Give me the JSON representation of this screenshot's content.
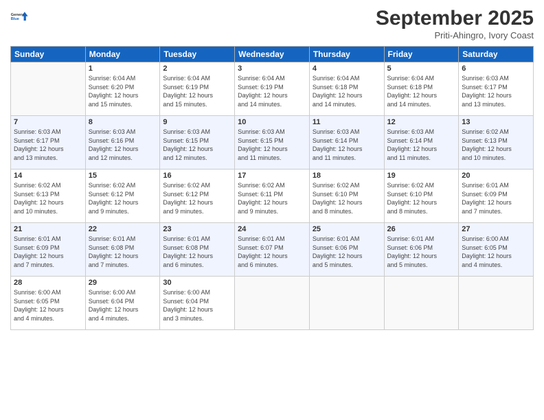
{
  "logo": {
    "line1": "General",
    "line2": "Blue"
  },
  "title": "September 2025",
  "location": "Priti-Ahingro, Ivory Coast",
  "days_of_week": [
    "Sunday",
    "Monday",
    "Tuesday",
    "Wednesday",
    "Thursday",
    "Friday",
    "Saturday"
  ],
  "weeks": [
    [
      {
        "num": "",
        "info": ""
      },
      {
        "num": "1",
        "info": "Sunrise: 6:04 AM\nSunset: 6:20 PM\nDaylight: 12 hours\nand 15 minutes."
      },
      {
        "num": "2",
        "info": "Sunrise: 6:04 AM\nSunset: 6:19 PM\nDaylight: 12 hours\nand 15 minutes."
      },
      {
        "num": "3",
        "info": "Sunrise: 6:04 AM\nSunset: 6:19 PM\nDaylight: 12 hours\nand 14 minutes."
      },
      {
        "num": "4",
        "info": "Sunrise: 6:04 AM\nSunset: 6:18 PM\nDaylight: 12 hours\nand 14 minutes."
      },
      {
        "num": "5",
        "info": "Sunrise: 6:04 AM\nSunset: 6:18 PM\nDaylight: 12 hours\nand 14 minutes."
      },
      {
        "num": "6",
        "info": "Sunrise: 6:03 AM\nSunset: 6:17 PM\nDaylight: 12 hours\nand 13 minutes."
      }
    ],
    [
      {
        "num": "7",
        "info": "Sunrise: 6:03 AM\nSunset: 6:17 PM\nDaylight: 12 hours\nand 13 minutes."
      },
      {
        "num": "8",
        "info": "Sunrise: 6:03 AM\nSunset: 6:16 PM\nDaylight: 12 hours\nand 12 minutes."
      },
      {
        "num": "9",
        "info": "Sunrise: 6:03 AM\nSunset: 6:15 PM\nDaylight: 12 hours\nand 12 minutes."
      },
      {
        "num": "10",
        "info": "Sunrise: 6:03 AM\nSunset: 6:15 PM\nDaylight: 12 hours\nand 11 minutes."
      },
      {
        "num": "11",
        "info": "Sunrise: 6:03 AM\nSunset: 6:14 PM\nDaylight: 12 hours\nand 11 minutes."
      },
      {
        "num": "12",
        "info": "Sunrise: 6:03 AM\nSunset: 6:14 PM\nDaylight: 12 hours\nand 11 minutes."
      },
      {
        "num": "13",
        "info": "Sunrise: 6:02 AM\nSunset: 6:13 PM\nDaylight: 12 hours\nand 10 minutes."
      }
    ],
    [
      {
        "num": "14",
        "info": "Sunrise: 6:02 AM\nSunset: 6:13 PM\nDaylight: 12 hours\nand 10 minutes."
      },
      {
        "num": "15",
        "info": "Sunrise: 6:02 AM\nSunset: 6:12 PM\nDaylight: 12 hours\nand 9 minutes."
      },
      {
        "num": "16",
        "info": "Sunrise: 6:02 AM\nSunset: 6:12 PM\nDaylight: 12 hours\nand 9 minutes."
      },
      {
        "num": "17",
        "info": "Sunrise: 6:02 AM\nSunset: 6:11 PM\nDaylight: 12 hours\nand 9 minutes."
      },
      {
        "num": "18",
        "info": "Sunrise: 6:02 AM\nSunset: 6:10 PM\nDaylight: 12 hours\nand 8 minutes."
      },
      {
        "num": "19",
        "info": "Sunrise: 6:02 AM\nSunset: 6:10 PM\nDaylight: 12 hours\nand 8 minutes."
      },
      {
        "num": "20",
        "info": "Sunrise: 6:01 AM\nSunset: 6:09 PM\nDaylight: 12 hours\nand 7 minutes."
      }
    ],
    [
      {
        "num": "21",
        "info": "Sunrise: 6:01 AM\nSunset: 6:09 PM\nDaylight: 12 hours\nand 7 minutes."
      },
      {
        "num": "22",
        "info": "Sunrise: 6:01 AM\nSunset: 6:08 PM\nDaylight: 12 hours\nand 7 minutes."
      },
      {
        "num": "23",
        "info": "Sunrise: 6:01 AM\nSunset: 6:08 PM\nDaylight: 12 hours\nand 6 minutes."
      },
      {
        "num": "24",
        "info": "Sunrise: 6:01 AM\nSunset: 6:07 PM\nDaylight: 12 hours\nand 6 minutes."
      },
      {
        "num": "25",
        "info": "Sunrise: 6:01 AM\nSunset: 6:06 PM\nDaylight: 12 hours\nand 5 minutes."
      },
      {
        "num": "26",
        "info": "Sunrise: 6:01 AM\nSunset: 6:06 PM\nDaylight: 12 hours\nand 5 minutes."
      },
      {
        "num": "27",
        "info": "Sunrise: 6:00 AM\nSunset: 6:05 PM\nDaylight: 12 hours\nand 4 minutes."
      }
    ],
    [
      {
        "num": "28",
        "info": "Sunrise: 6:00 AM\nSunset: 6:05 PM\nDaylight: 12 hours\nand 4 minutes."
      },
      {
        "num": "29",
        "info": "Sunrise: 6:00 AM\nSunset: 6:04 PM\nDaylight: 12 hours\nand 4 minutes."
      },
      {
        "num": "30",
        "info": "Sunrise: 6:00 AM\nSunset: 6:04 PM\nDaylight: 12 hours\nand 3 minutes."
      },
      {
        "num": "",
        "info": ""
      },
      {
        "num": "",
        "info": ""
      },
      {
        "num": "",
        "info": ""
      },
      {
        "num": "",
        "info": ""
      }
    ]
  ]
}
